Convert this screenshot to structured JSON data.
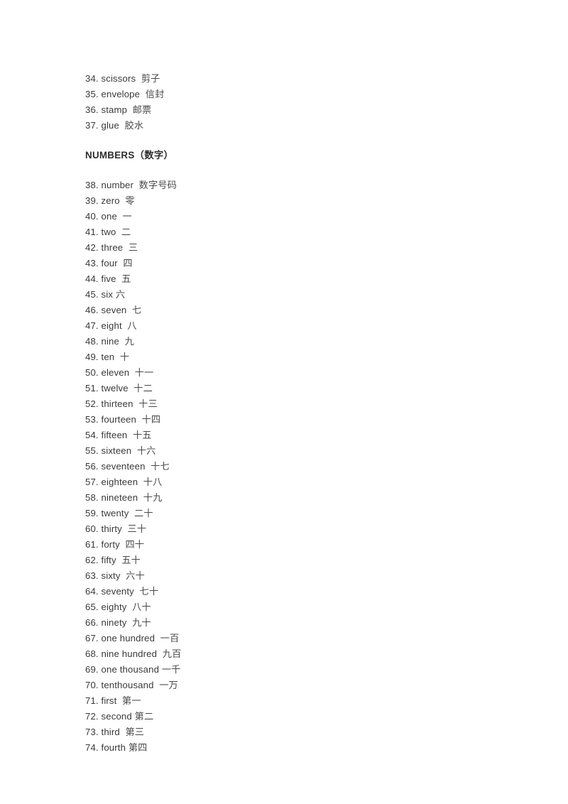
{
  "document": {
    "text_color": "#3a3a3a",
    "background_color": "#ffffff"
  },
  "blocks": [
    {
      "kind": "entry",
      "num": "34.",
      "en": "scissors",
      "gap": "  ",
      "zh": "剪子"
    },
    {
      "kind": "entry",
      "num": "35.",
      "en": "envelope",
      "gap": "  ",
      "zh": "信封"
    },
    {
      "kind": "entry",
      "num": "36.",
      "en": "stamp",
      "gap": "  ",
      "zh": "邮票"
    },
    {
      "kind": "entry",
      "num": "37.",
      "en": "glue",
      "gap": "  ",
      "zh": "胶水"
    },
    {
      "kind": "heading",
      "en": "NUMBERS",
      "zh": "（数字）"
    },
    {
      "kind": "entry",
      "num": "38.",
      "en": "number",
      "gap": "  ",
      "zh": "数字号码"
    },
    {
      "kind": "entry",
      "num": "39.",
      "en": "zero",
      "gap": "  ",
      "zh": "零"
    },
    {
      "kind": "entry",
      "num": "40.",
      "en": "one",
      "gap": "  ",
      "zh": "一"
    },
    {
      "kind": "entry",
      "num": "41.",
      "en": "two",
      "gap": "  ",
      "zh": "二"
    },
    {
      "kind": "entry",
      "num": "42.",
      "en": "three",
      "gap": "  ",
      "zh": "三"
    },
    {
      "kind": "entry",
      "num": "43.",
      "en": "four",
      "gap": "  ",
      "zh": "四"
    },
    {
      "kind": "entry",
      "num": "44.",
      "en": "five",
      "gap": "  ",
      "zh": "五"
    },
    {
      "kind": "entry",
      "num": "45.",
      "en": "six",
      "gap": " ",
      "zh": "六"
    },
    {
      "kind": "entry",
      "num": "46.",
      "en": "seven",
      "gap": "  ",
      "zh": "七"
    },
    {
      "kind": "entry",
      "num": "47.",
      "en": "eight",
      "gap": "  ",
      "zh": "八"
    },
    {
      "kind": "entry",
      "num": "48.",
      "en": "nine",
      "gap": "  ",
      "zh": "九"
    },
    {
      "kind": "entry",
      "num": "49.",
      "en": "ten",
      "gap": "  ",
      "zh": "十"
    },
    {
      "kind": "entry",
      "num": "50.",
      "en": "eleven",
      "gap": "  ",
      "zh": "十一"
    },
    {
      "kind": "entry",
      "num": "51.",
      "en": "twelve",
      "gap": "  ",
      "zh": "十二"
    },
    {
      "kind": "entry",
      "num": "52.",
      "en": "thirteen",
      "gap": "  ",
      "zh": "十三"
    },
    {
      "kind": "entry",
      "num": "53.",
      "en": "fourteen",
      "gap": "  ",
      "zh": "十四"
    },
    {
      "kind": "entry",
      "num": "54.",
      "en": "fifteen",
      "gap": "  ",
      "zh": "十五"
    },
    {
      "kind": "entry",
      "num": "55.",
      "en": "sixteen",
      "gap": "  ",
      "zh": "十六"
    },
    {
      "kind": "entry",
      "num": "56.",
      "en": "seventeen",
      "gap": "  ",
      "zh": "十七"
    },
    {
      "kind": "entry",
      "num": "57.",
      "en": "eighteen",
      "gap": "  ",
      "zh": "十八"
    },
    {
      "kind": "entry",
      "num": "58.",
      "en": "nineteen",
      "gap": "  ",
      "zh": "十九"
    },
    {
      "kind": "entry",
      "num": "59.",
      "en": "twenty",
      "gap": "  ",
      "zh": "二十"
    },
    {
      "kind": "entry",
      "num": "60.",
      "en": "thirty",
      "gap": "  ",
      "zh": "三十"
    },
    {
      "kind": "entry",
      "num": "61.",
      "en": "forty",
      "gap": "  ",
      "zh": "四十"
    },
    {
      "kind": "entry",
      "num": "62.",
      "en": "fifty",
      "gap": "  ",
      "zh": "五十"
    },
    {
      "kind": "entry",
      "num": "63.",
      "en": "sixty",
      "gap": "  ",
      "zh": "六十"
    },
    {
      "kind": "entry",
      "num": "64.",
      "en": "seventy",
      "gap": "  ",
      "zh": "七十"
    },
    {
      "kind": "entry",
      "num": "65.",
      "en": "eighty",
      "gap": "  ",
      "zh": "八十"
    },
    {
      "kind": "entry",
      "num": "66.",
      "en": "ninety",
      "gap": "  ",
      "zh": "九十"
    },
    {
      "kind": "entry",
      "num": "67.",
      "en": "one hundred",
      "gap": "  ",
      "zh": "一百"
    },
    {
      "kind": "entry",
      "num": "68.",
      "en": "nine hundred",
      "gap": "  ",
      "zh": "九百"
    },
    {
      "kind": "entry",
      "num": "69.",
      "en": "one thousand",
      "gap": " ",
      "zh": "一千"
    },
    {
      "kind": "entry",
      "num": "70.",
      "en": "tenthousand",
      "gap": "  ",
      "zh": "一万"
    },
    {
      "kind": "entry",
      "num": "71.",
      "en": "first",
      "gap": "  ",
      "zh": "第一"
    },
    {
      "kind": "entry",
      "num": "72.",
      "en": "second",
      "gap": " ",
      "zh": "第二"
    },
    {
      "kind": "entry",
      "num": "73.",
      "en": "third",
      "gap": "  ",
      "zh": "第三"
    },
    {
      "kind": "entry",
      "num": "74.",
      "en": "fourth",
      "gap": " ",
      "zh": "第四"
    }
  ]
}
